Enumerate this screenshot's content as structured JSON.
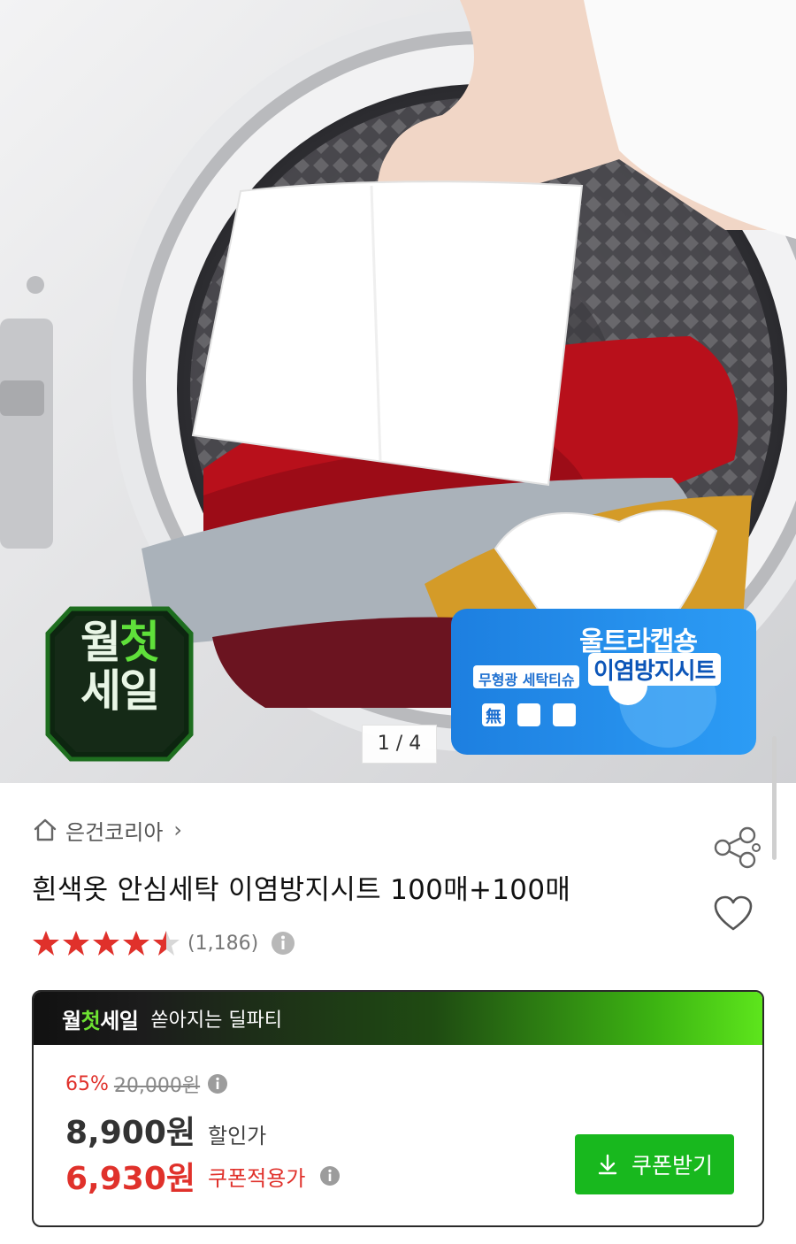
{
  "hero": {
    "slide_counter": "1 / 4",
    "badge_text": [
      "월",
      "첫",
      "세일"
    ],
    "package_texts": {
      "line1": "울트라캡숑",
      "line2": "이염방지시트",
      "sub": "무형광 세탁티슈",
      "tag": "無"
    }
  },
  "seller": {
    "name": "은건코리아",
    "chevron": "›"
  },
  "product": {
    "title": "흰색옷 안심세탁 이염방지시트 100매+100매",
    "rating_stars": 4.5,
    "review_count": "(1,186)"
  },
  "price_box": {
    "brand_parts": [
      "월",
      "첫",
      "세일"
    ],
    "slogan": "쏟아지는 딜파티",
    "discount_rate": "65%",
    "original_price": "20,000원",
    "sale_price": "8,900원",
    "sale_label": "할인가",
    "coupon_price": "6,930원",
    "coupon_label": "쿠폰적용가",
    "coupon_button": "쿠폰받기"
  },
  "colors": {
    "accent_red": "#e0312b",
    "accent_green": "#18b81e",
    "header_dark": "#111111",
    "star_red": "#e0312b"
  },
  "icons": [
    "home-icon",
    "chevron-right-icon",
    "share-icon",
    "heart-icon",
    "star-icon",
    "info-icon",
    "download-arrow-icon"
  ]
}
